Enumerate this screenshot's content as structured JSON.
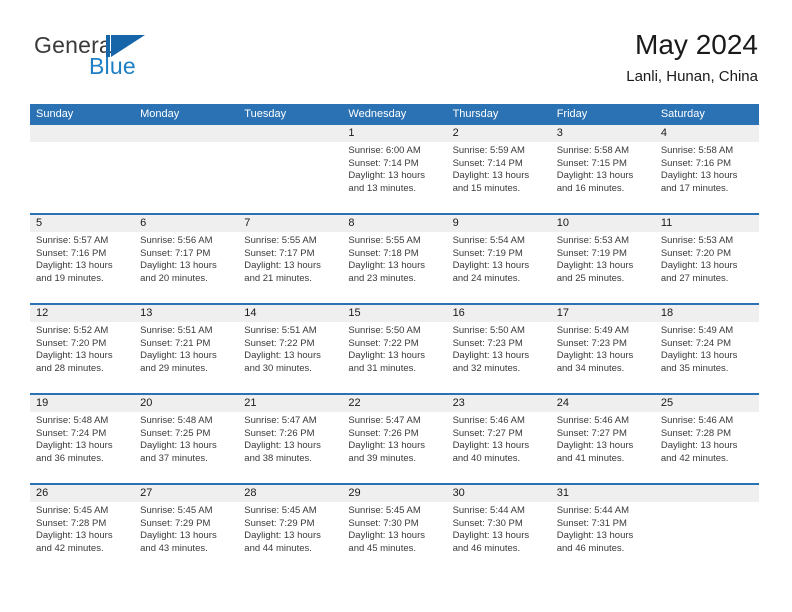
{
  "brand": {
    "word_one": "General",
    "word_two": "Blue",
    "mark": "triangle-logo"
  },
  "header": {
    "title": "May 2024",
    "subtitle": "Lanli, Hunan, China"
  },
  "calendar": {
    "day_headers": [
      "Sunday",
      "Monday",
      "Tuesday",
      "Wednesday",
      "Thursday",
      "Friday",
      "Saturday"
    ],
    "colors": {
      "header_blue": "#2b72b4",
      "number_band_gray": "#efefef",
      "brand_blue": "#1f7fc4",
      "text": "#3a3a3a"
    },
    "weeks": [
      [
        {
          "day": "",
          "lines": []
        },
        {
          "day": "",
          "lines": []
        },
        {
          "day": "",
          "lines": []
        },
        {
          "day": "1",
          "lines": [
            "Sunrise: 6:00 AM",
            "Sunset: 7:14 PM",
            "Daylight: 13 hours",
            "and 13 minutes."
          ]
        },
        {
          "day": "2",
          "lines": [
            "Sunrise: 5:59 AM",
            "Sunset: 7:14 PM",
            "Daylight: 13 hours",
            "and 15 minutes."
          ]
        },
        {
          "day": "3",
          "lines": [
            "Sunrise: 5:58 AM",
            "Sunset: 7:15 PM",
            "Daylight: 13 hours",
            "and 16 minutes."
          ]
        },
        {
          "day": "4",
          "lines": [
            "Sunrise: 5:58 AM",
            "Sunset: 7:16 PM",
            "Daylight: 13 hours",
            "and 17 minutes."
          ]
        }
      ],
      [
        {
          "day": "5",
          "lines": [
            "Sunrise: 5:57 AM",
            "Sunset: 7:16 PM",
            "Daylight: 13 hours",
            "and 19 minutes."
          ]
        },
        {
          "day": "6",
          "lines": [
            "Sunrise: 5:56 AM",
            "Sunset: 7:17 PM",
            "Daylight: 13 hours",
            "and 20 minutes."
          ]
        },
        {
          "day": "7",
          "lines": [
            "Sunrise: 5:55 AM",
            "Sunset: 7:17 PM",
            "Daylight: 13 hours",
            "and 21 minutes."
          ]
        },
        {
          "day": "8",
          "lines": [
            "Sunrise: 5:55 AM",
            "Sunset: 7:18 PM",
            "Daylight: 13 hours",
            "and 23 minutes."
          ]
        },
        {
          "day": "9",
          "lines": [
            "Sunrise: 5:54 AM",
            "Sunset: 7:19 PM",
            "Daylight: 13 hours",
            "and 24 minutes."
          ]
        },
        {
          "day": "10",
          "lines": [
            "Sunrise: 5:53 AM",
            "Sunset: 7:19 PM",
            "Daylight: 13 hours",
            "and 25 minutes."
          ]
        },
        {
          "day": "11",
          "lines": [
            "Sunrise: 5:53 AM",
            "Sunset: 7:20 PM",
            "Daylight: 13 hours",
            "and 27 minutes."
          ]
        }
      ],
      [
        {
          "day": "12",
          "lines": [
            "Sunrise: 5:52 AM",
            "Sunset: 7:20 PM",
            "Daylight: 13 hours",
            "and 28 minutes."
          ]
        },
        {
          "day": "13",
          "lines": [
            "Sunrise: 5:51 AM",
            "Sunset: 7:21 PM",
            "Daylight: 13 hours",
            "and 29 minutes."
          ]
        },
        {
          "day": "14",
          "lines": [
            "Sunrise: 5:51 AM",
            "Sunset: 7:22 PM",
            "Daylight: 13 hours",
            "and 30 minutes."
          ]
        },
        {
          "day": "15",
          "lines": [
            "Sunrise: 5:50 AM",
            "Sunset: 7:22 PM",
            "Daylight: 13 hours",
            "and 31 minutes."
          ]
        },
        {
          "day": "16",
          "lines": [
            "Sunrise: 5:50 AM",
            "Sunset: 7:23 PM",
            "Daylight: 13 hours",
            "and 32 minutes."
          ]
        },
        {
          "day": "17",
          "lines": [
            "Sunrise: 5:49 AM",
            "Sunset: 7:23 PM",
            "Daylight: 13 hours",
            "and 34 minutes."
          ]
        },
        {
          "day": "18",
          "lines": [
            "Sunrise: 5:49 AM",
            "Sunset: 7:24 PM",
            "Daylight: 13 hours",
            "and 35 minutes."
          ]
        }
      ],
      [
        {
          "day": "19",
          "lines": [
            "Sunrise: 5:48 AM",
            "Sunset: 7:24 PM",
            "Daylight: 13 hours",
            "and 36 minutes."
          ]
        },
        {
          "day": "20",
          "lines": [
            "Sunrise: 5:48 AM",
            "Sunset: 7:25 PM",
            "Daylight: 13 hours",
            "and 37 minutes."
          ]
        },
        {
          "day": "21",
          "lines": [
            "Sunrise: 5:47 AM",
            "Sunset: 7:26 PM",
            "Daylight: 13 hours",
            "and 38 minutes."
          ]
        },
        {
          "day": "22",
          "lines": [
            "Sunrise: 5:47 AM",
            "Sunset: 7:26 PM",
            "Daylight: 13 hours",
            "and 39 minutes."
          ]
        },
        {
          "day": "23",
          "lines": [
            "Sunrise: 5:46 AM",
            "Sunset: 7:27 PM",
            "Daylight: 13 hours",
            "and 40 minutes."
          ]
        },
        {
          "day": "24",
          "lines": [
            "Sunrise: 5:46 AM",
            "Sunset: 7:27 PM",
            "Daylight: 13 hours",
            "and 41 minutes."
          ]
        },
        {
          "day": "25",
          "lines": [
            "Sunrise: 5:46 AM",
            "Sunset: 7:28 PM",
            "Daylight: 13 hours",
            "and 42 minutes."
          ]
        }
      ],
      [
        {
          "day": "26",
          "lines": [
            "Sunrise: 5:45 AM",
            "Sunset: 7:28 PM",
            "Daylight: 13 hours",
            "and 42 minutes."
          ]
        },
        {
          "day": "27",
          "lines": [
            "Sunrise: 5:45 AM",
            "Sunset: 7:29 PM",
            "Daylight: 13 hours",
            "and 43 minutes."
          ]
        },
        {
          "day": "28",
          "lines": [
            "Sunrise: 5:45 AM",
            "Sunset: 7:29 PM",
            "Daylight: 13 hours",
            "and 44 minutes."
          ]
        },
        {
          "day": "29",
          "lines": [
            "Sunrise: 5:45 AM",
            "Sunset: 7:30 PM",
            "Daylight: 13 hours",
            "and 45 minutes."
          ]
        },
        {
          "day": "30",
          "lines": [
            "Sunrise: 5:44 AM",
            "Sunset: 7:30 PM",
            "Daylight: 13 hours",
            "and 46 minutes."
          ]
        },
        {
          "day": "31",
          "lines": [
            "Sunrise: 5:44 AM",
            "Sunset: 7:31 PM",
            "Daylight: 13 hours",
            "and 46 minutes."
          ]
        },
        {
          "day": "",
          "lines": []
        }
      ]
    ]
  }
}
